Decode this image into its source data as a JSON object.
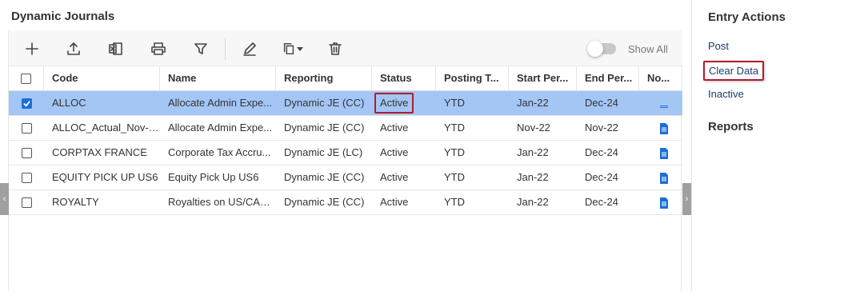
{
  "page": {
    "title": "Dynamic Journals"
  },
  "toolbar": {
    "buttons": [
      "add-icon",
      "upload-icon",
      "excel-export-icon",
      "print-icon",
      "filter-icon",
      "edit-icon",
      "copy-menu-icon",
      "delete-icon"
    ],
    "toggle_label": "Show All",
    "toggle_on": false
  },
  "grid": {
    "headers": {
      "code": "Code",
      "name": "Name",
      "reporting": "Reporting",
      "status": "Status",
      "posting": "Posting T...",
      "start": "Start Per...",
      "end": "End Per...",
      "notes": "No..."
    },
    "rows": [
      {
        "code": "ALLOC",
        "name": "Allocate Admin Expe...",
        "reporting": "Dynamic JE (CC)",
        "status": "Active",
        "posting": "YTD",
        "start": "Jan-22",
        "end": "Dec-24",
        "checked": true,
        "selected": true
      },
      {
        "code": "ALLOC_Actual_Nov-2...",
        "name": "Allocate Admin Expe...",
        "reporting": "Dynamic JE (CC)",
        "status": "Active",
        "posting": "YTD",
        "start": "Nov-22",
        "end": "Nov-22",
        "checked": false,
        "selected": false
      },
      {
        "code": "CORPTAX FRANCE",
        "name": "Corporate Tax Accru...",
        "reporting": "Dynamic JE (LC)",
        "status": "Active",
        "posting": "YTD",
        "start": "Jan-22",
        "end": "Dec-24",
        "checked": false,
        "selected": false
      },
      {
        "code": "EQUITY PICK UP US6",
        "name": "Equity Pick Up US6",
        "reporting": "Dynamic JE (CC)",
        "status": "Active",
        "posting": "YTD",
        "start": "Jan-22",
        "end": "Dec-24",
        "checked": false,
        "selected": false
      },
      {
        "code": "ROYALTY",
        "name": "Royalties on US/CAN...",
        "reporting": "Dynamic JE (CC)",
        "status": "Active",
        "posting": "YTD",
        "start": "Jan-22",
        "end": "Dec-24",
        "checked": false,
        "selected": false
      }
    ]
  },
  "sidebar": {
    "entry_actions_title": "Entry Actions",
    "actions": [
      "Post",
      "Clear Data",
      "Inactive"
    ],
    "reports_title": "Reports"
  },
  "colors": {
    "selected_row": "#a3c6f5",
    "highlight_border": "#b01b2b",
    "checkbox_checked": "#1a6fd8",
    "link": "#1f3b6e"
  }
}
